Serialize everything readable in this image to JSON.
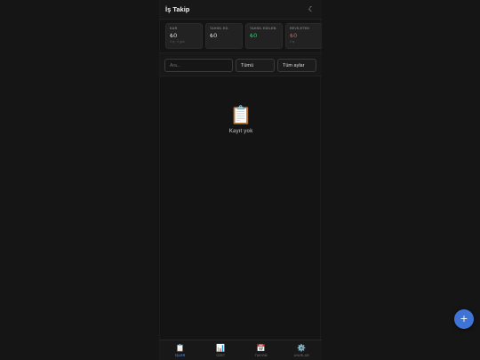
{
  "header": {
    "title": "İş Takip",
    "theme_icon": "☾"
  },
  "stats": [
    {
      "label": "KAR",
      "value": "₺0",
      "sub": "0 iş · 0 gün",
      "color": "#d8d8d8"
    },
    {
      "label": "TAHSİL ED.",
      "value": "₺0",
      "sub": "",
      "color": "#d8d8d8"
    },
    {
      "label": "TAHSİL EDİLEB.",
      "value": "₺0",
      "sub": "",
      "color": "#3fbf6f"
    },
    {
      "label": "REVİLETEN",
      "value": "₺0",
      "sub": "0 iş",
      "color": "#e05050"
    }
  ],
  "filters": {
    "search_placeholder": "Ara...",
    "status": "Tümü",
    "month": "Tüm aylar"
  },
  "empty": {
    "icon": "📋",
    "text": "Kayıt yok"
  },
  "fab": {
    "label": "+"
  },
  "nav": [
    {
      "icon": "📋",
      "label": "İŞLER",
      "active": true
    },
    {
      "icon": "📊",
      "label": "ÖZET",
      "active": false
    },
    {
      "icon": "📅",
      "label": "TAKVİM",
      "active": false
    },
    {
      "icon": "⚙️",
      "label": "AYARLAR",
      "active": false
    }
  ],
  "colors": {
    "accent": "#3f74d6",
    "positive": "#3fbf6f",
    "negative": "#e05050"
  }
}
